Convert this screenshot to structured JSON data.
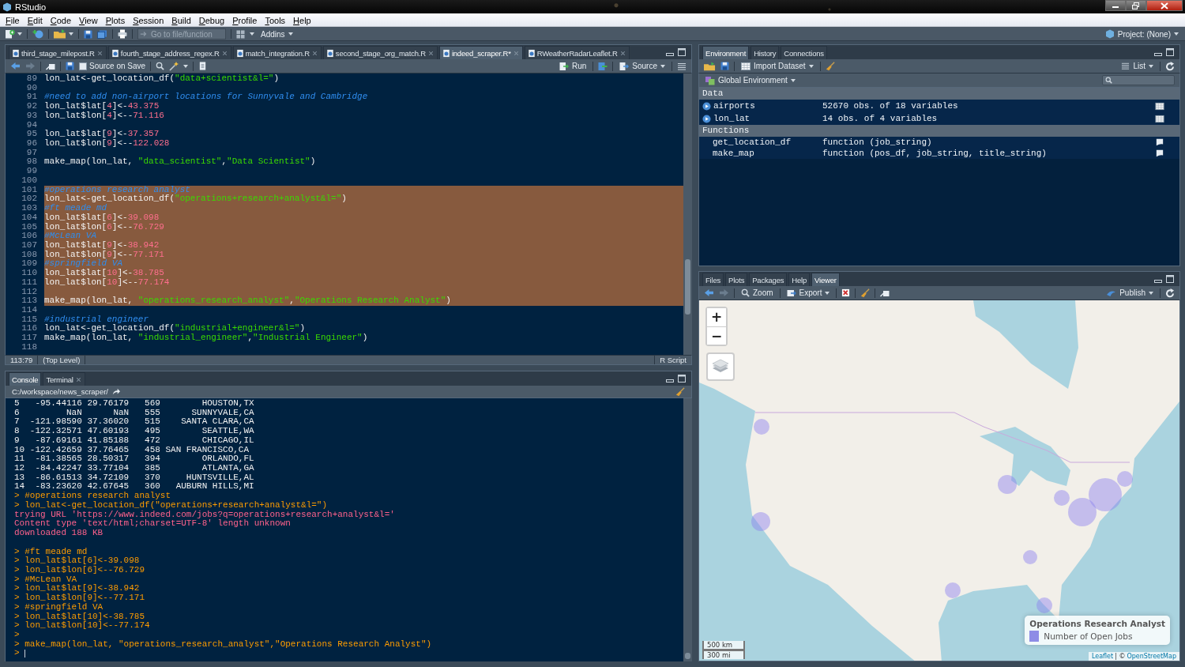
{
  "window": {
    "title": "RStudio"
  },
  "menu": [
    "File",
    "Edit",
    "Code",
    "View",
    "Plots",
    "Session",
    "Build",
    "Debug",
    "Profile",
    "Tools",
    "Help"
  ],
  "main_toolbar": {
    "goto_placeholder": "Go to file/function",
    "addins": "Addins",
    "project": "Project: (None)"
  },
  "editor": {
    "tabs": [
      {
        "label": "third_stage_milepost.R",
        "selected": false,
        "closable": true
      },
      {
        "label": "fourth_stage_address_regex.R",
        "selected": false,
        "closable": true
      },
      {
        "label": "match_integration.R",
        "selected": false,
        "closable": true
      },
      {
        "label": "second_stage_org_match.R",
        "selected": false,
        "closable": true
      },
      {
        "label": "indeed_scraper.R*",
        "selected": true,
        "closable": true
      },
      {
        "label": "RWeatherRadarLeaflet.R",
        "selected": false,
        "closable": true
      }
    ],
    "toolbar": {
      "source_on_save": {
        "label": "Source on Save",
        "checked": false
      },
      "run": "Run",
      "source": "Source"
    },
    "lines": [
      {
        "number": "89",
        "selected": false,
        "tokens": [
          {
            "kind": "code",
            "text": "lon_lat<-get_location_df("
          },
          {
            "kind": "string",
            "text": "\"data+scientist&l=\""
          },
          {
            "kind": "code",
            "text": ")"
          }
        ]
      },
      {
        "number": "90",
        "selected": false
      },
      {
        "number": "91",
        "selected": false,
        "tokens": [
          {
            "kind": "comment",
            "text": "#need to add non-airport locations for Sunnyvale and Cambridge"
          }
        ]
      },
      {
        "number": "92",
        "selected": false,
        "tokens": [
          {
            "kind": "code",
            "text": "lon_lat$lat["
          },
          {
            "kind": "number",
            "text": "4"
          },
          {
            "kind": "code",
            "text": "]<-"
          },
          {
            "kind": "number",
            "text": "43.375"
          }
        ]
      },
      {
        "number": "93",
        "selected": false,
        "tokens": [
          {
            "kind": "code",
            "text": "lon_lat$lon["
          },
          {
            "kind": "number",
            "text": "4"
          },
          {
            "kind": "code",
            "text": "]<--"
          },
          {
            "kind": "number",
            "text": "71.116"
          }
        ]
      },
      {
        "number": "94",
        "selected": false
      },
      {
        "number": "95",
        "selected": false,
        "tokens": [
          {
            "kind": "code",
            "text": "lon_lat$lat["
          },
          {
            "kind": "number",
            "text": "9"
          },
          {
            "kind": "code",
            "text": "]<-"
          },
          {
            "kind": "number",
            "text": "37.357"
          }
        ]
      },
      {
        "number": "96",
        "selected": false,
        "tokens": [
          {
            "kind": "code",
            "text": "lon_lat$lon["
          },
          {
            "kind": "number",
            "text": "9"
          },
          {
            "kind": "code",
            "text": "]<--"
          },
          {
            "kind": "number",
            "text": "122.028"
          }
        ]
      },
      {
        "number": "97",
        "selected": false
      },
      {
        "number": "98",
        "selected": false,
        "tokens": [
          {
            "kind": "code",
            "text": "make_map(lon_lat, "
          },
          {
            "kind": "string",
            "text": "\"data_scientist\""
          },
          {
            "kind": "code",
            "text": ","
          },
          {
            "kind": "string",
            "text": "\"Data Scientist\""
          },
          {
            "kind": "code",
            "text": ")"
          }
        ]
      },
      {
        "number": "99",
        "selected": false
      },
      {
        "number": "100",
        "selected": false
      },
      {
        "number": "101",
        "selected": true,
        "tokens": [
          {
            "kind": "comment",
            "text": "#operations research analyst"
          }
        ]
      },
      {
        "number": "102",
        "selected": true,
        "tokens": [
          {
            "kind": "code",
            "text": "lon_lat<-get_location_df("
          },
          {
            "kind": "string",
            "text": "\"operations+research+analyst&l=\""
          },
          {
            "kind": "code",
            "text": ")"
          }
        ]
      },
      {
        "number": "103",
        "selected": true,
        "tokens": [
          {
            "kind": "comment",
            "text": "#ft meade md"
          }
        ]
      },
      {
        "number": "104",
        "selected": true,
        "tokens": [
          {
            "kind": "code",
            "text": "lon_lat$lat["
          },
          {
            "kind": "number",
            "text": "6"
          },
          {
            "kind": "code",
            "text": "]<-"
          },
          {
            "kind": "number",
            "text": "39.098"
          }
        ]
      },
      {
        "number": "105",
        "selected": true,
        "tokens": [
          {
            "kind": "code",
            "text": "lon_lat$lon["
          },
          {
            "kind": "number",
            "text": "6"
          },
          {
            "kind": "code",
            "text": "]<--"
          },
          {
            "kind": "number",
            "text": "76.729"
          }
        ]
      },
      {
        "number": "106",
        "selected": true,
        "tokens": [
          {
            "kind": "comment",
            "text": "#McLean VA"
          }
        ]
      },
      {
        "number": "107",
        "selected": true,
        "tokens": [
          {
            "kind": "code",
            "text": "lon_lat$lat["
          },
          {
            "kind": "number",
            "text": "9"
          },
          {
            "kind": "code",
            "text": "]<-"
          },
          {
            "kind": "number",
            "text": "38.942"
          }
        ]
      },
      {
        "number": "108",
        "selected": true,
        "tokens": [
          {
            "kind": "code",
            "text": "lon_lat$lon["
          },
          {
            "kind": "number",
            "text": "9"
          },
          {
            "kind": "code",
            "text": "]<--"
          },
          {
            "kind": "number",
            "text": "77.171"
          }
        ]
      },
      {
        "number": "109",
        "selected": true,
        "tokens": [
          {
            "kind": "comment",
            "text": "#springfield VA"
          }
        ]
      },
      {
        "number": "110",
        "selected": true,
        "tokens": [
          {
            "kind": "code",
            "text": "lon_lat$lat["
          },
          {
            "kind": "number",
            "text": "10"
          },
          {
            "kind": "code",
            "text": "]<-"
          },
          {
            "kind": "number",
            "text": "38.785"
          }
        ]
      },
      {
        "number": "111",
        "selected": true,
        "tokens": [
          {
            "kind": "code",
            "text": "lon_lat$lon["
          },
          {
            "kind": "number",
            "text": "10"
          },
          {
            "kind": "code",
            "text": "]<--"
          },
          {
            "kind": "number",
            "text": "77.174"
          }
        ]
      },
      {
        "number": "112",
        "selected": true
      },
      {
        "number": "113",
        "selected": true,
        "tokens": [
          {
            "kind": "code",
            "text": "make_map(lon_lat, "
          },
          {
            "kind": "string",
            "text": "\"operations_research_analyst\""
          },
          {
            "kind": "code",
            "text": ","
          },
          {
            "kind": "string",
            "text": "\"Operations Research Analyst\""
          },
          {
            "kind": "code",
            "text": ")"
          }
        ]
      },
      {
        "number": "114",
        "selected": false
      },
      {
        "number": "115",
        "selected": false,
        "tokens": [
          {
            "kind": "comment",
            "text": "#industrial engineer"
          }
        ]
      },
      {
        "number": "116",
        "selected": false,
        "tokens": [
          {
            "kind": "code",
            "text": "lon_lat<-get_location_df("
          },
          {
            "kind": "string",
            "text": "\"industrial+engineer&l=\""
          },
          {
            "kind": "code",
            "text": ")"
          }
        ]
      },
      {
        "number": "117",
        "selected": false,
        "tokens": [
          {
            "kind": "code",
            "text": "make_map(lon_lat, "
          },
          {
            "kind": "string",
            "text": "\"industrial_engineer\""
          },
          {
            "kind": "code",
            "text": ","
          },
          {
            "kind": "string",
            "text": "\"Industrial Engineer\""
          },
          {
            "kind": "code",
            "text": ")"
          }
        ]
      },
      {
        "number": "118",
        "selected": false
      }
    ],
    "status": {
      "position": "113:79",
      "scope": "(Top Level)",
      "file_type": "R Script"
    }
  },
  "console": {
    "tabs": [
      {
        "label": "Console",
        "selected": true,
        "closable": false
      },
      {
        "label": "Terminal",
        "selected": false,
        "closable": true
      }
    ],
    "path": "C:/workspace/news_scraper/",
    "lines": [
      {
        "kind": "output",
        "text": "5   -95.44116 29.76179   569        HOUSTON,TX"
      },
      {
        "kind": "output",
        "text": "6         NaN      NaN   555      SUNNYVALE,CA"
      },
      {
        "kind": "output",
        "text": "7  -121.98590 37.36020   515    SANTA CLARA,CA"
      },
      {
        "kind": "output",
        "text": "8  -122.32571 47.60193   495        SEATTLE,WA"
      },
      {
        "kind": "output",
        "text": "9   -87.69161 41.85188   472        CHICAGO,IL"
      },
      {
        "kind": "output",
        "text": "10 -122.42659 37.76465   458 SAN FRANCISCO,CA"
      },
      {
        "kind": "output",
        "text": "11  -81.38565 28.50317   394        ORLANDO,FL"
      },
      {
        "kind": "output",
        "text": "12  -84.42247 33.77104   385        ATLANTA,GA"
      },
      {
        "kind": "output",
        "text": "13  -86.61513 34.72109   370     HUNTSVILLE,AL"
      },
      {
        "kind": "output",
        "text": "14  -83.23620 42.67645   360   AUBURN HILLS,MI"
      },
      {
        "kind": "input",
        "text": "> #operations research analyst"
      },
      {
        "kind": "input",
        "text": "> lon_lat<-get_location_df(\"operations+research+analyst&l=\")"
      },
      {
        "kind": "message",
        "text": "trying URL 'https://www.indeed.com/jobs?q=operations+research+analyst&l='"
      },
      {
        "kind": "message",
        "text": "Content type 'text/html;charset=UTF-8' length unknown"
      },
      {
        "kind": "message",
        "text": "downloaded 188 KB"
      },
      {
        "kind": "blank"
      },
      {
        "kind": "input",
        "text": "> #ft meade md"
      },
      {
        "kind": "input",
        "text": "> lon_lat$lat[6]<-39.098"
      },
      {
        "kind": "input",
        "text": "> lon_lat$lon[6]<--76.729"
      },
      {
        "kind": "input",
        "text": "> #McLean VA"
      },
      {
        "kind": "input",
        "text": "> lon_lat$lat[9]<-38.942"
      },
      {
        "kind": "input",
        "text": "> lon_lat$lon[9]<--77.171"
      },
      {
        "kind": "input",
        "text": "> #springfield VA"
      },
      {
        "kind": "input",
        "text": "> lon_lat$lat[10]<-38.785"
      },
      {
        "kind": "input",
        "text": "> lon_lat$lon[10]<--77.174"
      },
      {
        "kind": "input",
        "text": ">"
      },
      {
        "kind": "input",
        "text": "> make_map(lon_lat, \"operations_research_analyst\",\"Operations Research Analyst\")"
      },
      {
        "kind": "prompt",
        "text": ">"
      }
    ]
  },
  "environment": {
    "tabs": [
      {
        "label": "Environment",
        "selected": true
      },
      {
        "label": "History",
        "selected": false
      },
      {
        "label": "Connections",
        "selected": false
      }
    ],
    "toolbar": {
      "import": "Import Dataset",
      "view": "List"
    },
    "scope": "Global Environment",
    "sections": [
      {
        "title": "Data",
        "items": [
          {
            "kind": "data",
            "name": "airports",
            "value": "52670 obs. of 18 variables"
          },
          {
            "kind": "data",
            "name": "lon_lat",
            "value": "14 obs. of 4 variables"
          }
        ]
      },
      {
        "title": "Functions",
        "items": [
          {
            "kind": "function",
            "name": "get_location_df",
            "value": "function (job_string)"
          },
          {
            "kind": "function",
            "name": "make_map",
            "value": "function (pos_df, job_string, title_string)"
          }
        ]
      }
    ]
  },
  "viewer": {
    "tabs": [
      {
        "label": "Files",
        "selected": false
      },
      {
        "label": "Plots",
        "selected": false
      },
      {
        "label": "Packages",
        "selected": false
      },
      {
        "label": "Help",
        "selected": false
      },
      {
        "label": "Viewer",
        "selected": true
      }
    ],
    "toolbar": {
      "zoom": "Zoom",
      "export": "Export",
      "publish": "Publish"
    },
    "map": {
      "kind": "picture",
      "zoom_in": "+",
      "zoom_out": "−",
      "legend": {
        "title": "Operations Research Analyst",
        "label": "Number of Open Jobs"
      },
      "scale": [
        "500 km",
        "300 mi"
      ],
      "attribution": {
        "leaflet": "Leaflet",
        "separator": "| ©",
        "osm": "OpenStreetMap"
      }
    }
  }
}
